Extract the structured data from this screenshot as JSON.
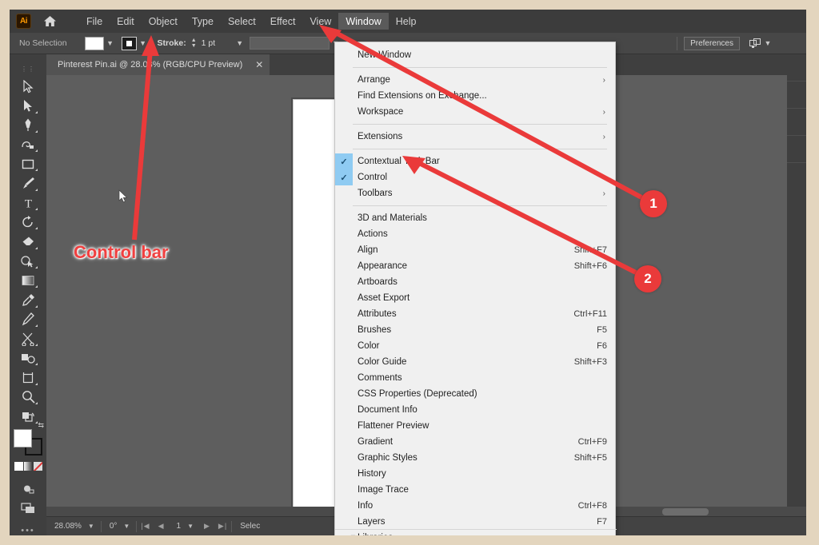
{
  "app": {
    "logo_text": "Ai",
    "home_icon": "home-icon"
  },
  "menubar": {
    "items": [
      {
        "label": "File",
        "active": false
      },
      {
        "label": "Edit",
        "active": false
      },
      {
        "label": "Object",
        "active": false
      },
      {
        "label": "Type",
        "active": false
      },
      {
        "label": "Select",
        "active": false
      },
      {
        "label": "Effect",
        "active": false
      },
      {
        "label": "View",
        "active": false
      },
      {
        "label": "Window",
        "active": true
      },
      {
        "label": "Help",
        "active": false
      }
    ]
  },
  "controlbar": {
    "selection_status": "No Selection",
    "fill_swatch": "#ffffff",
    "stroke_label": "Stroke:",
    "stroke_weight": "1 pt",
    "preferences_label": "Preferences",
    "arrange_icon": "arrange-documents-icon",
    "caret_icon": "chevron-down-icon"
  },
  "document_tab": {
    "title": "Pinterest Pin.ai @ 28.08% (RGB/CPU Preview)",
    "close_icon": "close-icon"
  },
  "toolbar": {
    "tools": [
      {
        "name": "selection-tool"
      },
      {
        "name": "direct-selection-tool"
      },
      {
        "name": "pen-tool"
      },
      {
        "name": "curvature-tool"
      },
      {
        "name": "rectangle-tool"
      },
      {
        "name": "paintbrush-tool"
      },
      {
        "name": "type-tool"
      },
      {
        "name": "rotate-tool"
      },
      {
        "name": "eraser-tool"
      },
      {
        "name": "shape-builder-tool"
      },
      {
        "name": "gradient-tool"
      },
      {
        "name": "eyedropper-tool"
      },
      {
        "name": "pencil-tool"
      },
      {
        "name": "scissors-tool"
      },
      {
        "name": "blend-tool"
      },
      {
        "name": "artboard-tool"
      },
      {
        "name": "zoom-tool"
      },
      {
        "name": "hand-tool"
      }
    ],
    "fill_color": "#ffffff",
    "stroke_color": "#000000",
    "screen_mode_icon": "screen-mode-icon",
    "more_tools_icon": "more-tools-icon"
  },
  "window_menu": {
    "items": [
      {
        "label": "New Window",
        "shortcut": "",
        "checked": false,
        "submenu": false,
        "separator_after": true
      },
      {
        "label": "Arrange",
        "shortcut": "",
        "checked": false,
        "submenu": true,
        "separator_after": false
      },
      {
        "label": "Find Extensions on Exchange...",
        "shortcut": "",
        "checked": false,
        "submenu": false,
        "separator_after": false
      },
      {
        "label": "Workspace",
        "shortcut": "",
        "checked": false,
        "submenu": true,
        "separator_after": true
      },
      {
        "label": "Extensions",
        "shortcut": "",
        "checked": false,
        "submenu": true,
        "separator_after": true
      },
      {
        "label": "Contextual Task Bar",
        "shortcut": "",
        "checked": true,
        "submenu": false,
        "separator_after": false
      },
      {
        "label": "Control",
        "shortcut": "",
        "checked": true,
        "submenu": false,
        "separator_after": false
      },
      {
        "label": "Toolbars",
        "shortcut": "",
        "checked": false,
        "submenu": true,
        "separator_after": true
      },
      {
        "label": "3D and Materials",
        "shortcut": "",
        "checked": false,
        "submenu": false,
        "separator_after": false
      },
      {
        "label": "Actions",
        "shortcut": "",
        "checked": false,
        "submenu": false,
        "separator_after": false
      },
      {
        "label": "Align",
        "shortcut": "Shift+F7",
        "checked": false,
        "submenu": false,
        "separator_after": false
      },
      {
        "label": "Appearance",
        "shortcut": "Shift+F6",
        "checked": false,
        "submenu": false,
        "separator_after": false
      },
      {
        "label": "Artboards",
        "shortcut": "",
        "checked": false,
        "submenu": false,
        "separator_after": false
      },
      {
        "label": "Asset Export",
        "shortcut": "",
        "checked": false,
        "submenu": false,
        "separator_after": false
      },
      {
        "label": "Attributes",
        "shortcut": "Ctrl+F11",
        "checked": false,
        "submenu": false,
        "separator_after": false
      },
      {
        "label": "Brushes",
        "shortcut": "F5",
        "checked": false,
        "submenu": false,
        "separator_after": false
      },
      {
        "label": "Color",
        "shortcut": "F6",
        "checked": false,
        "submenu": false,
        "separator_after": false
      },
      {
        "label": "Color Guide",
        "shortcut": "Shift+F3",
        "checked": false,
        "submenu": false,
        "separator_after": false
      },
      {
        "label": "Comments",
        "shortcut": "",
        "checked": false,
        "submenu": false,
        "separator_after": false
      },
      {
        "label": "CSS Properties (Deprecated)",
        "shortcut": "",
        "checked": false,
        "submenu": false,
        "separator_after": false
      },
      {
        "label": "Document Info",
        "shortcut": "",
        "checked": false,
        "submenu": false,
        "separator_after": false
      },
      {
        "label": "Flattener Preview",
        "shortcut": "",
        "checked": false,
        "submenu": false,
        "separator_after": false
      },
      {
        "label": "Gradient",
        "shortcut": "Ctrl+F9",
        "checked": false,
        "submenu": false,
        "separator_after": false
      },
      {
        "label": "Graphic Styles",
        "shortcut": "Shift+F5",
        "checked": false,
        "submenu": false,
        "separator_after": false
      },
      {
        "label": "History",
        "shortcut": "",
        "checked": false,
        "submenu": false,
        "separator_after": false
      },
      {
        "label": "Image Trace",
        "shortcut": "",
        "checked": false,
        "submenu": false,
        "separator_after": false
      },
      {
        "label": "Info",
        "shortcut": "Ctrl+F8",
        "checked": false,
        "submenu": false,
        "separator_after": false
      },
      {
        "label": "Layers",
        "shortcut": "F7",
        "checked": false,
        "submenu": false,
        "separator_after": false
      },
      {
        "label": "Libraries",
        "shortcut": "",
        "checked": false,
        "submenu": false,
        "separator_after": false
      }
    ],
    "scroll_down_icon": "scroll-down-arrow-icon"
  },
  "statusbar": {
    "zoom_level": "28.08%",
    "rotation": "0°",
    "artboard_number": "1",
    "status_text": "Selec",
    "first_icon": "first-artboard-icon",
    "prev_icon": "previous-artboard-icon",
    "next_icon": "next-artboard-icon",
    "last_icon": "last-artboard-icon"
  },
  "annotations": {
    "control_bar_label": "Control bar",
    "badge_1": "1",
    "badge_2": "2",
    "arrow_color": "#ea3a3a",
    "label_color": "#f04040"
  }
}
